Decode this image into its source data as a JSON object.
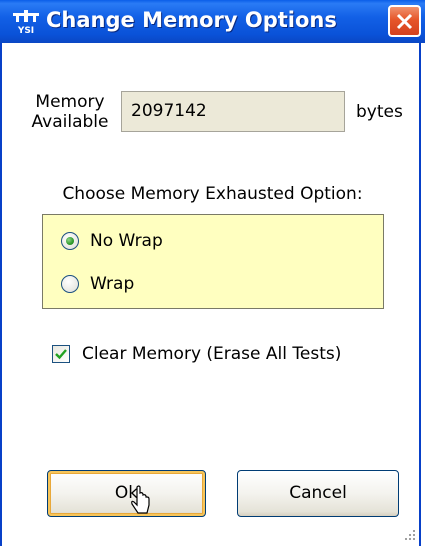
{
  "window": {
    "title": "Change Memory Options",
    "icon": "ysi-logo-icon",
    "close_icon": "close-icon"
  },
  "memory": {
    "label_line1": "Memory",
    "label_line2": "Available",
    "value": "2097142",
    "unit": "bytes"
  },
  "exhausted": {
    "heading": "Choose Memory Exhausted Option:",
    "options": [
      {
        "label": "No Wrap",
        "selected": true
      },
      {
        "label": "Wrap",
        "selected": false
      }
    ]
  },
  "clear_memory": {
    "label": "Clear Memory (Erase All Tests)",
    "checked": true
  },
  "buttons": {
    "ok": "Ok",
    "cancel": "Cancel"
  },
  "colors": {
    "title_bar": "#0a52d8",
    "option_box": "#ffffc0",
    "close_button": "#e6562a"
  }
}
